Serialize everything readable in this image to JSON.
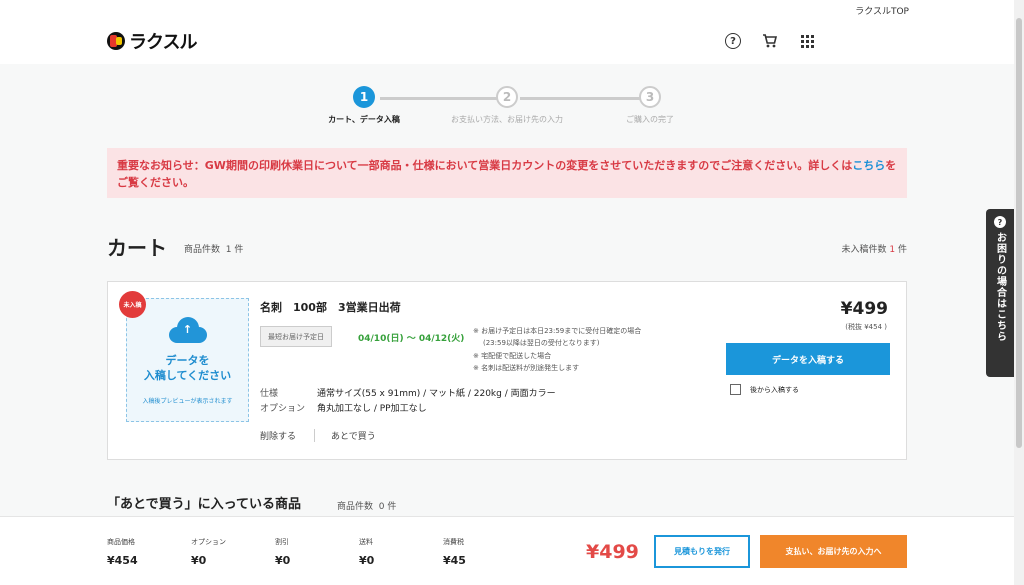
{
  "topbar": {
    "top_link": "ラクスルTOP"
  },
  "header": {
    "logo_text": "ラクスル",
    "icons": [
      "help-icon",
      "cart-icon",
      "apps-grid-icon"
    ]
  },
  "steps": [
    {
      "num": "1",
      "label": "カート、データ入稿",
      "active": true
    },
    {
      "num": "2",
      "label": "お支払い方法、お届け先の入力",
      "active": false
    },
    {
      "num": "3",
      "label": "ご購入の完了",
      "active": false
    }
  ],
  "notice": {
    "text": "重要なお知らせ：GW期間の印刷休業日について一部商品・仕様において営業日カウントの変更をさせていただきますのでご注意ください。詳しくは",
    "link": "こちら",
    "after": "をご覧ください。"
  },
  "cart": {
    "title": "カート",
    "count_label": "商品件数",
    "count_value": "1",
    "count_unit": "件",
    "unsubmitted_label": "未入稿件数",
    "unsubmitted_value": "1",
    "unsubmitted_unit": "件"
  },
  "item": {
    "badge": "未入稿",
    "upload_text_1": "データを",
    "upload_text_2": "入稿してください",
    "upload_sub": "入稿後プレビューが表示されます",
    "name": "名刺　100部　3営業日出荷",
    "delivery_tag": "最短お届け予定日",
    "delivery_date": "04/10(日) 〜 04/12(火)",
    "notes": [
      "※ お届け予定日は本日23:59までに受付日確定の場合",
      "(23:59以降は翌日の受付となります)",
      "※ 宅配便で配送した場合",
      "※ 名刺は配送料が別途発生します"
    ],
    "spec_label": "仕様",
    "spec_value": "通常サイズ(55 x 91mm) / マット紙 / 220kg / 両面カラー",
    "option_label": "オプション",
    "option_value": "角丸加工なし / PP加工なし",
    "delete_label": "削除する",
    "save_later_label": "あとで買う",
    "price": "¥499",
    "price_tax": "(税抜 ¥454 )",
    "upload_button": "データを入稿する",
    "later_checkbox": "後から入稿する"
  },
  "saved": {
    "title": "「あとで買う」に入っている商品",
    "count_label": "商品件数",
    "count_value": "0",
    "count_unit": "件"
  },
  "footer": {
    "cols": [
      {
        "label": "商品価格",
        "value": "¥454"
      },
      {
        "label": "オプション",
        "value": "¥0"
      },
      {
        "label": "割引",
        "value": "¥0"
      },
      {
        "label": "送料",
        "value": "¥0"
      },
      {
        "label": "消費税",
        "value": "¥45"
      }
    ],
    "total": "¥499",
    "quote_button": "見積もりを発行",
    "checkout_button": "支払い、お届け先の入力へ"
  },
  "side_help": {
    "text": "お困りの場合はこちら"
  },
  "colors": {
    "accent": "#1b96da",
    "alert": "#d83a44",
    "checkout": "#f0862b",
    "date_green": "#37a13c"
  }
}
